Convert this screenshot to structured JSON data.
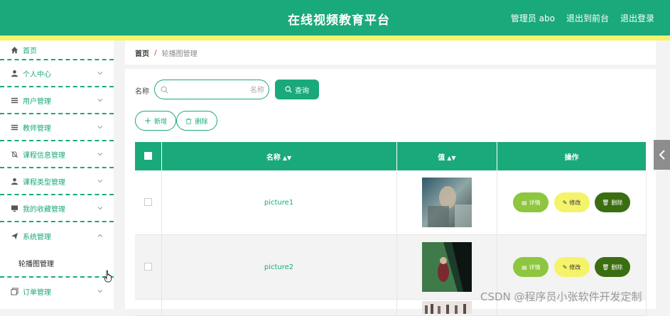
{
  "header": {
    "title": "在线视频教育平台",
    "admin": "管理员 abo",
    "to_front": "退出到前台",
    "logout": "退出登录"
  },
  "sidebar": {
    "items": [
      {
        "label": "首页",
        "icon": "home-icon"
      },
      {
        "label": "个人中心",
        "icon": "user-icon"
      },
      {
        "label": "用户管理",
        "icon": "list-icon"
      },
      {
        "label": "教师管理",
        "icon": "list-icon"
      },
      {
        "label": "课程信息管理",
        "icon": "bell-off-icon"
      },
      {
        "label": "课程类型管理",
        "icon": "user-icon"
      },
      {
        "label": "我的收藏管理",
        "icon": "monitor-icon"
      },
      {
        "label": "系统管理",
        "icon": "send-icon"
      }
    ],
    "sub_item": "轮播图管理",
    "last_item": "订单管理"
  },
  "breadcrumb": {
    "home": "首页",
    "separator": "/",
    "current": "轮播图管理"
  },
  "search": {
    "label": "名称",
    "placeholder": "名称",
    "button": "查询"
  },
  "actions": {
    "add": "新增",
    "delete": "删除"
  },
  "table": {
    "headers": {
      "name": "名称",
      "value": "值",
      "ops": "操作"
    },
    "rows": [
      {
        "name": "picture1"
      },
      {
        "name": "picture2"
      }
    ],
    "row_actions": {
      "detail": "详情",
      "edit": "修改",
      "delete": "删除"
    }
  },
  "watermark": "CSDN @程序员小张软件开发定制",
  "colors": {
    "primary": "#1aa97a",
    "accent_yellow": "#f4f36a",
    "detail": "#8ec63f",
    "delete": "#3b6e10"
  }
}
